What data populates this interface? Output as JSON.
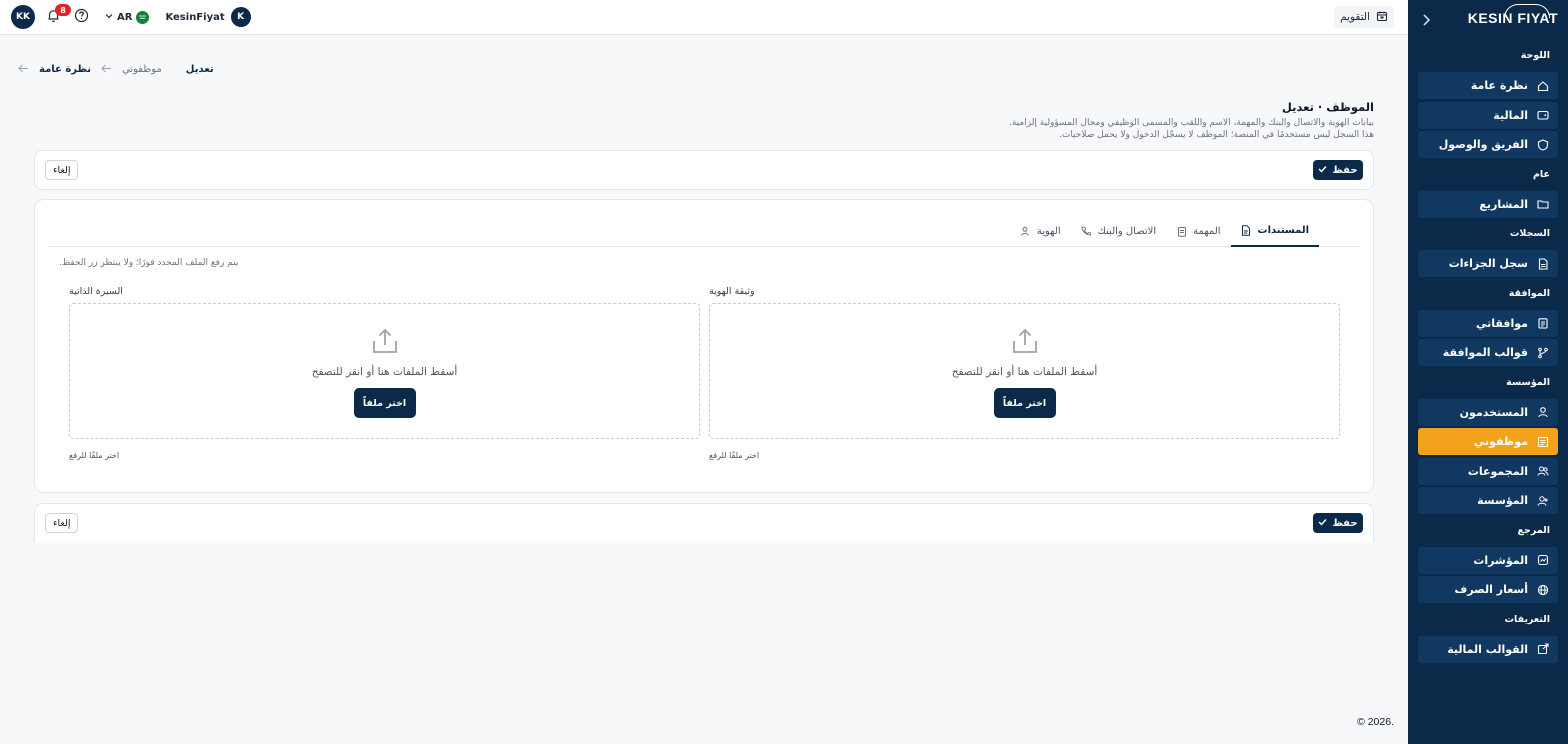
{
  "sidebar": {
    "logo": "KESIN FIYAT",
    "sections": [
      {
        "label": "اللوحة",
        "items": [
          {
            "label": "نظرة عامة",
            "icon": "home-icon"
          },
          {
            "label": "المالية",
            "icon": "wallet-icon"
          },
          {
            "label": "الفريق والوصول",
            "icon": "shield-icon"
          }
        ]
      },
      {
        "label": "عام",
        "items": [
          {
            "label": "المشاريع",
            "icon": "folder-icon"
          }
        ]
      },
      {
        "label": "السجلات",
        "items": [
          {
            "label": "سجل الجزاءات",
            "icon": "file-icon"
          }
        ]
      },
      {
        "label": "الموافقة",
        "items": [
          {
            "label": "موافقاتي",
            "icon": "clipboard-icon"
          },
          {
            "label": "قوالب الموافقة",
            "icon": "branch-icon"
          }
        ]
      },
      {
        "label": "المؤسسة",
        "items": [
          {
            "label": "المستخدمون",
            "icon": "user-icon"
          },
          {
            "label": "موظفوني",
            "icon": "id-card-icon",
            "active": true
          },
          {
            "label": "المجموعات",
            "icon": "users-icon"
          },
          {
            "label": "المؤسسة",
            "icon": "building-icon"
          }
        ]
      },
      {
        "label": "المرجع",
        "items": [
          {
            "label": "المؤشرات",
            "icon": "chart-icon"
          },
          {
            "label": "أسعار الصرف",
            "icon": "globe-icon"
          }
        ]
      },
      {
        "label": "التعريفات",
        "items": [
          {
            "label": "القوالب المالية",
            "icon": "external-icon"
          }
        ]
      }
    ],
    "active_color": "#f2a31b",
    "bg_color": "#0b2a4a"
  },
  "topbar": {
    "user_initials": "KK",
    "notification_count": "8",
    "language": "AR",
    "org_name": "KesinFiyat",
    "org_initial": "K",
    "calendar_label": "التقويم"
  },
  "breadcrumb": {
    "home": "نظرة عامة",
    "section": "موظفوني",
    "current": "تعديل"
  },
  "page": {
    "title": "الموظف · تعديل",
    "description_1": "بيانات الهوية والاتصال والبنك والمهمة، الاسم واللقب والمسمى الوظيفي ومجال المسؤولية إلزامية.",
    "description_2": "هذا السجل ليس مستخدمًا في المنصة؛ الموظف لا يسجّل الدخول ولا يحمل صلاحيات."
  },
  "actions": {
    "save": "حفظ",
    "cancel": "إلغاء"
  },
  "tabs": [
    {
      "label": "المستندات",
      "icon": "document-icon",
      "active": true
    },
    {
      "label": "المهمة",
      "icon": "clipboard-icon"
    },
    {
      "label": "الاتصال والبنك",
      "icon": "phone-icon"
    },
    {
      "label": "الهوية",
      "icon": "user-icon"
    }
  ],
  "documents": {
    "hint": "يتم رفع الملف المحدد فورًا؛ ولا ينتظر زر الحفظ.",
    "id_document": {
      "label": "وثيقة الهوية",
      "drop_text": "أسقط الملفات هنا أو انقر للتصفح",
      "button": "اختر ملفاً",
      "help": "اختر ملفًا للرفع"
    },
    "cv": {
      "label": "السيرة الذاتية",
      "drop_text": "أسقط الملفات هنا أو انقر للتصفح",
      "button": "اختر ملفاً",
      "help": "اختر ملفًا للرفع"
    }
  },
  "footer": "© 2026."
}
